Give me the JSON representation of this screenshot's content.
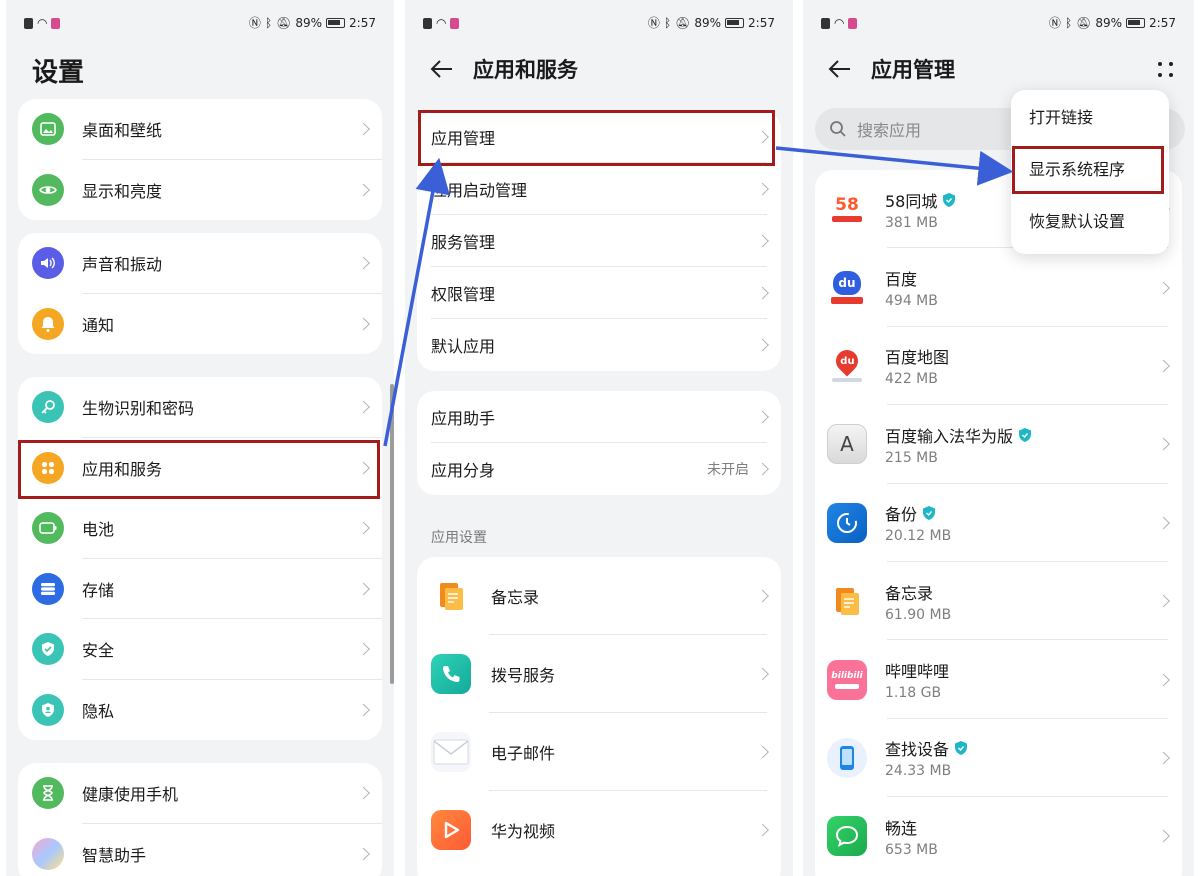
{
  "status": {
    "battery": "89%",
    "time": "2:57"
  },
  "panel1": {
    "title": "设置",
    "groups": [
      [
        {
          "label": "桌面和壁纸",
          "icon": "wallpaper-icon"
        },
        {
          "label": "显示和亮度",
          "icon": "eye-icon"
        }
      ],
      [
        {
          "label": "声音和振动",
          "icon": "speaker-icon"
        },
        {
          "label": "通知",
          "icon": "bell-icon"
        }
      ],
      [
        {
          "label": "生物识别和密码",
          "icon": "key-icon"
        },
        {
          "label": "应用和服务",
          "icon": "apps-grid-icon"
        },
        {
          "label": "电池",
          "icon": "battery-icon"
        },
        {
          "label": "存储",
          "icon": "storage-icon"
        },
        {
          "label": "安全",
          "icon": "shield-check-icon"
        },
        {
          "label": "隐私",
          "icon": "privacy-icon"
        }
      ],
      [
        {
          "label": "健康使用手机",
          "icon": "hourglass-icon"
        },
        {
          "label": "智慧助手",
          "icon": "assistant-icon"
        }
      ]
    ]
  },
  "panel2": {
    "title": "应用和服务",
    "group1": [
      "应用管理",
      "应用启动管理",
      "服务管理",
      "权限管理",
      "默认应用"
    ],
    "group2": [
      {
        "label": "应用助手",
        "value": ""
      },
      {
        "label": "应用分身",
        "value": "未开启"
      }
    ],
    "section_label": "应用设置",
    "apps": [
      {
        "label": "备忘录",
        "icon": "notes-app-icon"
      },
      {
        "label": "拨号服务",
        "icon": "phone-app-icon"
      },
      {
        "label": "电子邮件",
        "icon": "email-app-icon"
      },
      {
        "label": "华为视频",
        "icon": "video-app-icon"
      }
    ]
  },
  "panel3": {
    "title": "应用管理",
    "search_placeholder": "搜索应用",
    "menu": [
      "打开链接",
      "显示系统程序",
      "恢复默认设置"
    ],
    "apps": [
      {
        "name": "58同城",
        "size": "381 MB",
        "verified": true,
        "icon": "58tongcheng-app-icon"
      },
      {
        "name": "百度",
        "size": "494 MB",
        "verified": false,
        "icon": "baidu-app-icon"
      },
      {
        "name": "百度地图",
        "size": "422 MB",
        "verified": false,
        "icon": "baidu-map-app-icon"
      },
      {
        "name": "百度输入法华为版",
        "size": "215 MB",
        "verified": true,
        "icon": "baidu-input-app-icon"
      },
      {
        "name": "备份",
        "size": "20.12 MB",
        "verified": true,
        "icon": "backup-app-icon"
      },
      {
        "name": "备忘录",
        "size": "61.90 MB",
        "verified": false,
        "icon": "notes-app-icon"
      },
      {
        "name": "哔哩哔哩",
        "size": "1.18 GB",
        "verified": false,
        "icon": "bilibili-app-icon"
      },
      {
        "name": "查找设备",
        "size": "24.33 MB",
        "verified": true,
        "icon": "find-device-app-icon"
      },
      {
        "name": "畅连",
        "size": "653 MB",
        "verified": false,
        "icon": "meetime-app-icon"
      }
    ],
    "icon_texts": {
      "58tongcheng": "58",
      "baidu": "du",
      "baidu_map": "du",
      "baidu_input": "A",
      "bilibili": "bilibili"
    }
  },
  "colors": {
    "highlight": "#a31c1c",
    "arrow": "#3b5fd6",
    "verified": "#1fb7c6"
  }
}
